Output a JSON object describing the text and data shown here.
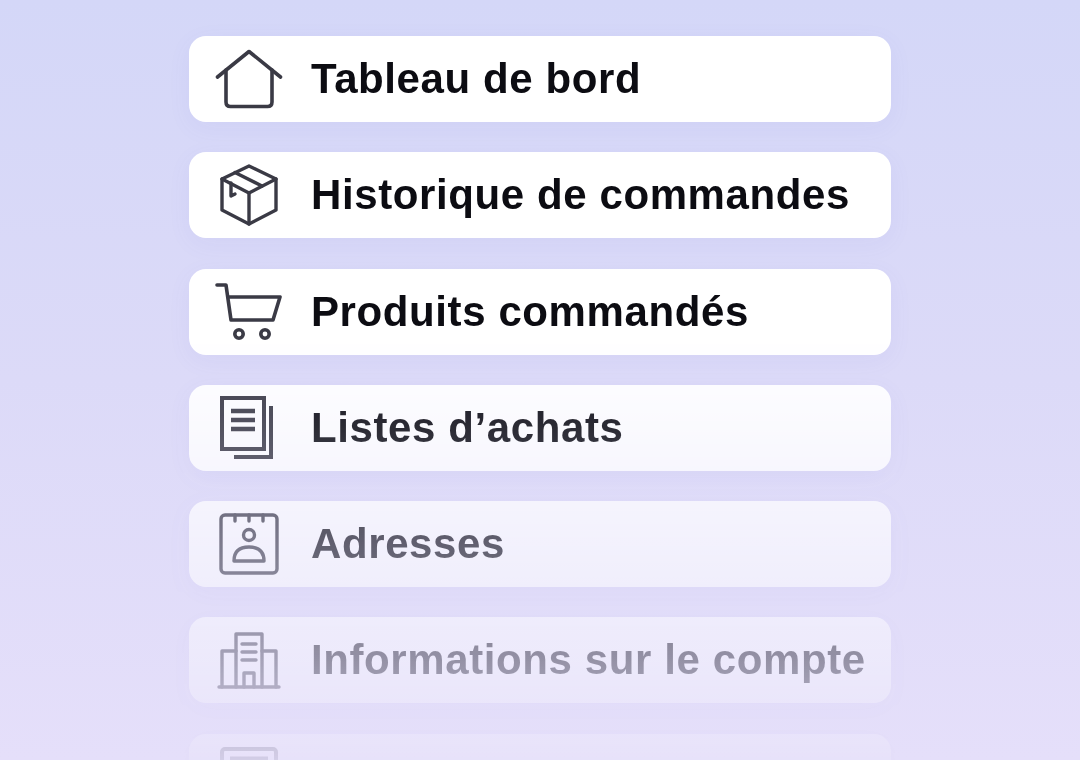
{
  "menu": {
    "items": [
      {
        "label": "Tableau de bord"
      },
      {
        "label": "Historique de commandes"
      },
      {
        "label": "Produits commandés"
      },
      {
        "label": "Listes d’achats"
      },
      {
        "label": "Adresses"
      },
      {
        "label": "Informations sur le compte"
      }
    ],
    "more_below": true
  }
}
